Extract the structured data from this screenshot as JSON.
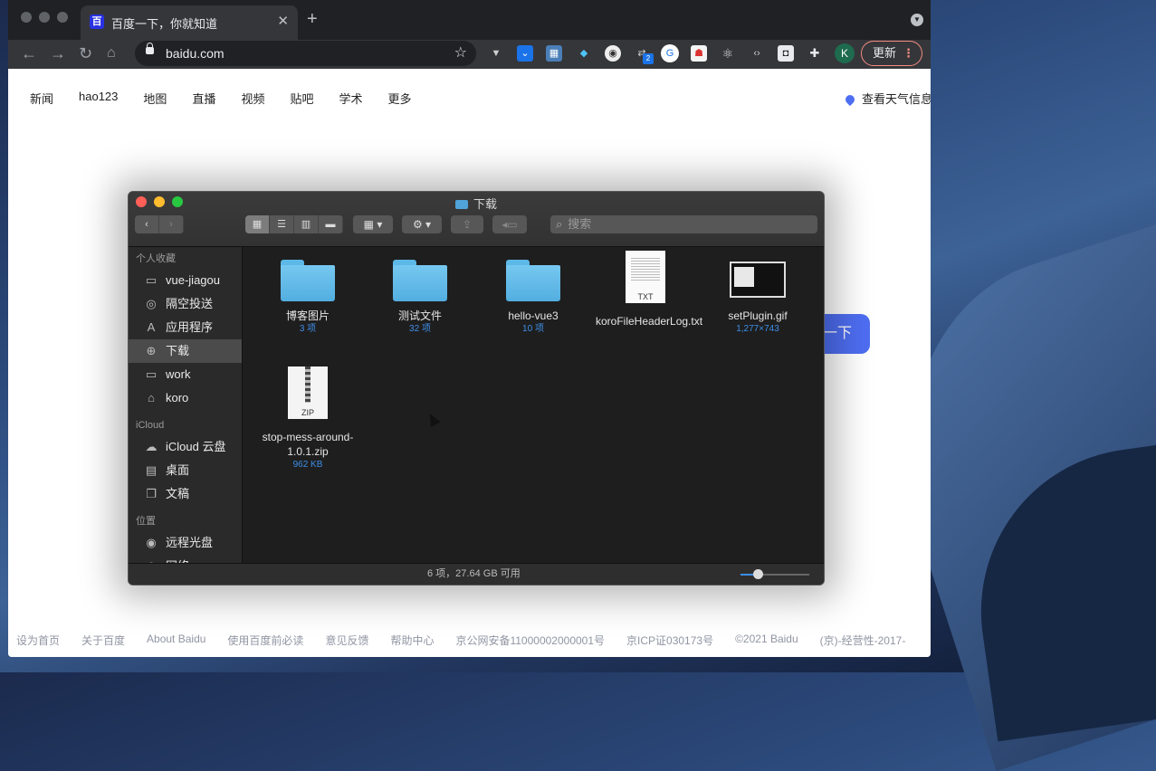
{
  "browser": {
    "tab_title": "百度一下，你就知道",
    "favicon_text": "百",
    "tab_close": "✕",
    "new_tab": "+",
    "url": "baidu.com",
    "update_label": "更新",
    "profile_initial": "K",
    "ext_badge": "2",
    "extensions": [
      "vue-devtools-icon",
      "pocket-icon",
      "image-icon",
      "gem-icon",
      "counter-icon",
      "network-icon",
      "translate-icon",
      "robot-icon",
      "react-icon",
      "code-icon",
      "capture-icon",
      "puzzle-icon"
    ]
  },
  "baidu": {
    "nav": [
      "新闻",
      "hao123",
      "地图",
      "直播",
      "视频",
      "贴吧",
      "学术",
      "更多"
    ],
    "weather": "查看天气信息",
    "search_button": "一下",
    "footer": [
      "设为首页",
      "关于百度",
      "About Baidu",
      "使用百度前必读",
      "意见反馈",
      "帮助中心",
      "京公网安备11000002000001号",
      "京ICP证030173号",
      "©2021 Baidu",
      "(京)-经营性-2017-"
    ]
  },
  "finder": {
    "title": "下载",
    "search_placeholder": "搜索",
    "sidebar": {
      "favorites_header": "个人收藏",
      "favorites": [
        "vue-jiagou",
        "隔空投送",
        "应用程序",
        "下载",
        "work",
        "koro"
      ],
      "icloud_header": "iCloud",
      "icloud": [
        "iCloud 云盘",
        "桌面",
        "文稿"
      ],
      "locations_header": "位置",
      "locations": [
        "远程光盘",
        "网络"
      ]
    },
    "files": [
      {
        "name": "博客图片",
        "sub": "3 项"
      },
      {
        "name": "测试文件",
        "sub": "32 项"
      },
      {
        "name": "hello-vue3",
        "sub": "10 项"
      },
      {
        "name": "koroFileHeaderLog.txt",
        "sub": "",
        "badge": "TXT"
      },
      {
        "name": "setPlugin.gif",
        "sub": "1,277×743"
      },
      {
        "name": "stop-mess-around-1.0.1.zip",
        "sub": "962 KB",
        "badge": "ZIP"
      }
    ],
    "status": "6 项，27.64 GB 可用",
    "icon_size_level": 0.25
  }
}
